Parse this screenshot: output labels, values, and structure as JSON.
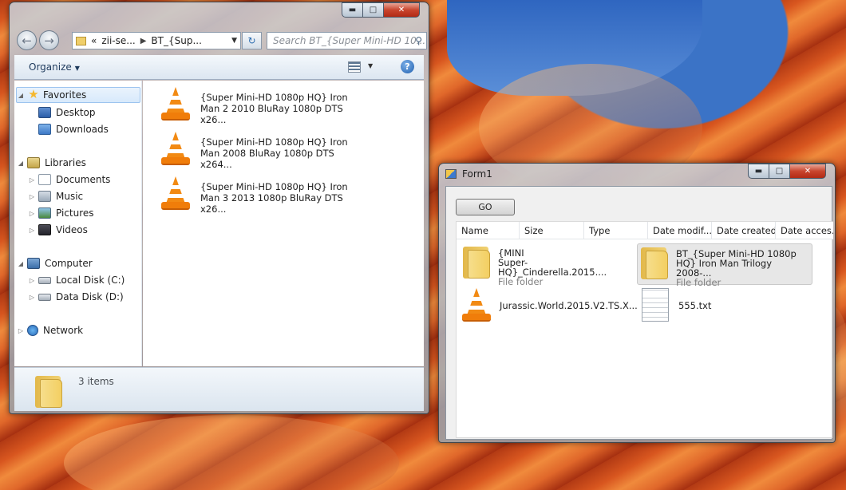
{
  "explorer": {
    "address": {
      "overflow": "«",
      "crumb1": "zii-se...",
      "crumb2": "BT_{Sup..."
    },
    "search": {
      "placeholder": "Search BT_{Super Mini-HD 10..."
    },
    "toolbar": {
      "organize": "Organize"
    },
    "nav": {
      "favorites": "Favorites",
      "desktop": "Desktop",
      "downloads": "Downloads",
      "libraries": "Libraries",
      "documents": "Documents",
      "music": "Music",
      "pictures": "Pictures",
      "videos": "Videos",
      "computer": "Computer",
      "local_disk": "Local Disk (C:)",
      "data_disk": "Data Disk (D:)",
      "network": "Network"
    },
    "files": [
      {
        "line1": "{Super Mini-HD 1080p HQ} Iron",
        "line2": "Man 2 2010 BluRay 1080p DTS x26..."
      },
      {
        "line1": "{Super Mini-HD 1080p HQ} Iron",
        "line2": "Man 2008 BluRay 1080p DTS x264..."
      },
      {
        "line1": "{Super Mini-HD 1080p HQ} Iron",
        "line2": "Man 3 2013 1080p BluRay DTS x26..."
      }
    ],
    "status": {
      "count": "3 items"
    }
  },
  "form1": {
    "title": "Form1",
    "go_button": "GO",
    "columns": [
      "Name",
      "Size",
      "Type",
      "Date modif...",
      "Date created",
      "Date acces..."
    ],
    "items": [
      {
        "line1": "{MINI",
        "line2": "Super-HQ}_Cinderella.2015....",
        "sub": "File folder"
      },
      {
        "line1": "BT_{Super Mini-HD 1080p",
        "line2": "HQ} Iron Man Trilogy 2008-...",
        "sub": "File folder"
      },
      {
        "line1": "Jurassic.World.2015.V2.TS.X...",
        "line2": "",
        "sub": ""
      },
      {
        "line1": "555.txt",
        "line2": "",
        "sub": ""
      }
    ]
  },
  "icons": {
    "vlc": "vlc-cone-icon",
    "folder": "folder-icon",
    "text_file": "text-file-icon"
  },
  "colors": {
    "accent": "#3c7ad0",
    "selection": "#d7e9fb",
    "vlc_orange": "#f28a13"
  }
}
